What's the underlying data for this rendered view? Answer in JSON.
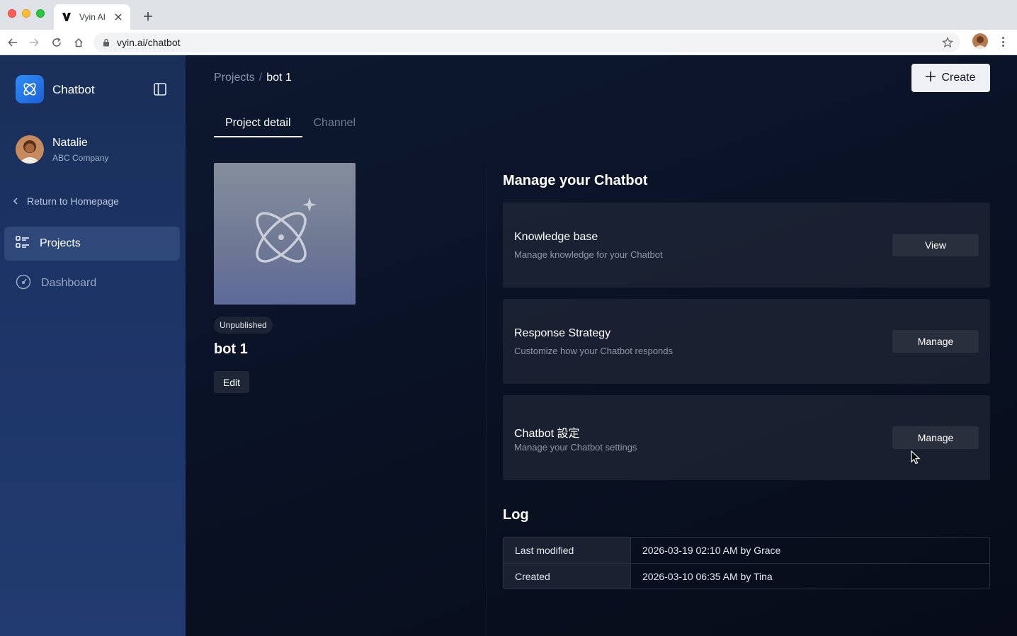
{
  "browser": {
    "tab_title": "Vyin AI",
    "url": "vyin.ai/chatbot"
  },
  "sidebar": {
    "app_name": "Chatbot",
    "user": {
      "name": "Natalie",
      "company": "ABC Company"
    },
    "return_label": "Return to Homepage",
    "items": [
      {
        "label": "Projects",
        "icon": "list-icon",
        "active": true
      },
      {
        "label": "Dashboard",
        "icon": "dashboard-icon",
        "active": false
      }
    ]
  },
  "header": {
    "breadcrumb": {
      "parent": "Projects",
      "separator": "/",
      "current": "bot 1"
    },
    "create_label": "Create"
  },
  "tabs": [
    {
      "label": "Project detail",
      "active": true
    },
    {
      "label": "Channel",
      "active": false
    }
  ],
  "project": {
    "status": "Unpublished",
    "name": "bot 1",
    "edit_label": "Edit"
  },
  "manage": {
    "title": "Manage your Chatbot",
    "cards": [
      {
        "title": "Knowledge base",
        "desc": "Manage knowledge for your Chatbot",
        "button": "View"
      },
      {
        "title": "Response Strategy",
        "desc": "Customize how your Chatbot responds",
        "button": "Manage"
      },
      {
        "title": "Chatbot 設定",
        "desc": "Manage your Chatbot settings",
        "button": "Manage"
      }
    ]
  },
  "log": {
    "title": "Log",
    "rows": [
      {
        "label": "Last modified",
        "value": "2026-03-19 02:10 AM by Grace"
      },
      {
        "label": "Created",
        "value": "2026-03-10 06:35 AM by Tina"
      }
    ]
  }
}
